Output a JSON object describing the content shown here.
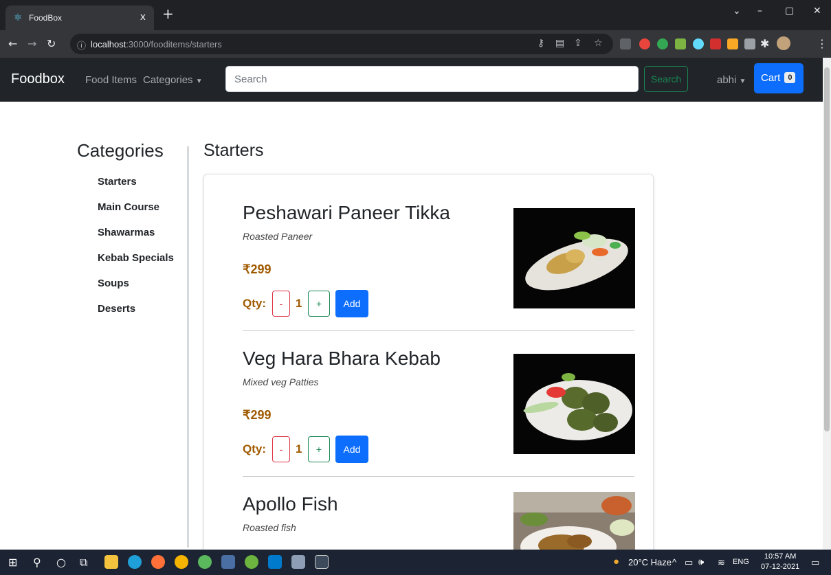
{
  "browser": {
    "tab_title": "FoodBox",
    "tab_close": "x",
    "new_tab": "+",
    "url_host": "localhost",
    "url_path": ":3000/fooditems/starters"
  },
  "navbar": {
    "brand": "Foodbox",
    "food_items": "Food Items",
    "categories": "Categories",
    "search_placeholder": "Search",
    "search_button": "Search",
    "user": "abhi",
    "cart_label": "Cart",
    "cart_count": "0"
  },
  "sidebar": {
    "title": "Categories",
    "items": [
      "Starters",
      "Main Course",
      "Shawarmas",
      "Kebab Specials",
      "Soups",
      "Deserts"
    ]
  },
  "section": {
    "title": "Starters"
  },
  "items": [
    {
      "name": "Peshawari Paneer Tikka",
      "desc": "Roasted Paneer",
      "price": "₹299",
      "qty_label": "Qty:",
      "minus": "-",
      "qty": "1",
      "plus": "+",
      "add": "Add"
    },
    {
      "name": "Veg Hara Bhara Kebab",
      "desc": "Mixed veg Patties",
      "price": "₹299",
      "qty_label": "Qty:",
      "minus": "-",
      "qty": "1",
      "plus": "+",
      "add": "Add"
    },
    {
      "name": "Apollo Fish",
      "desc": "Roasted fish"
    }
  ],
  "taskbar": {
    "weather": "20°C  Haze",
    "lang": "ENG",
    "time": "10:57 AM",
    "date": "07-12-2021"
  },
  "colors": {
    "navbar_bg": "#212529",
    "primary": "#0d6efd",
    "success": "#198754",
    "danger": "#dc3545",
    "price": "#a05a00"
  }
}
